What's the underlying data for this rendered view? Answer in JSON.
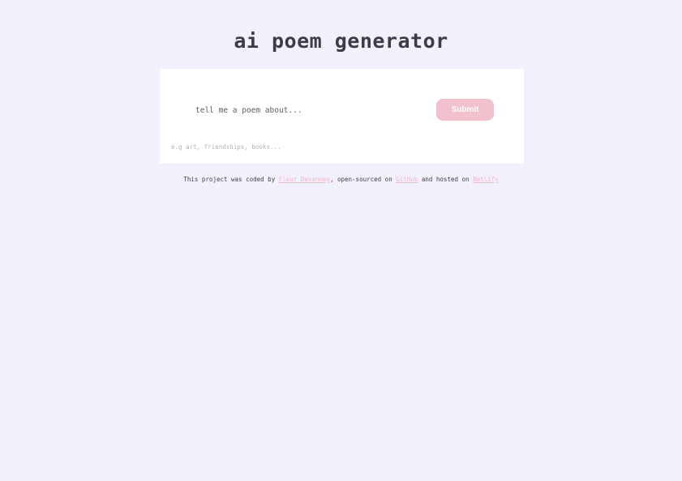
{
  "header": {
    "title": "ai poem generator"
  },
  "form": {
    "input_placeholder": "tell me a poem about...",
    "input_value": "",
    "submit_label": "Submit",
    "hint": "e.g art, friendships, books..."
  },
  "footer": {
    "text_1": "This project was coded by ",
    "author_link": "Fleur Devanney",
    "text_2": ", open-sourced on ",
    "github_link": "GitHub",
    "text_3": " and hosted on ",
    "netlify_link": "Netlify"
  },
  "colors": {
    "background": "#f2f0fd",
    "card": "#ffffff",
    "accent": "#f1c1cc",
    "link": "#efb9c6",
    "text": "#3f3f45"
  }
}
